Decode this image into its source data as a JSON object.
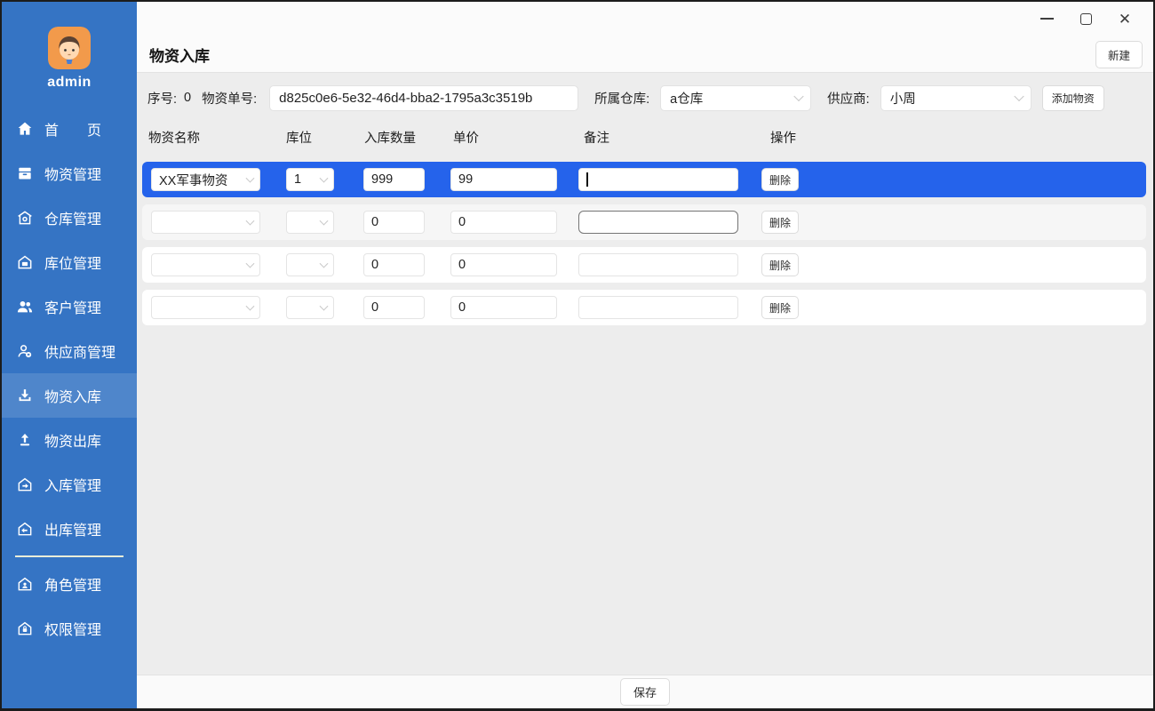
{
  "colors": {
    "sidebar_background": "#3574c4",
    "sidebar_selected": "#4f86cb",
    "row_selected": "#2563eb",
    "avatar_orange": "#f29a4b",
    "content_background": "#ededed"
  },
  "sidebar": {
    "avatar_name": "admin",
    "items": [
      {
        "label": "首　　页",
        "icon": "home-icon",
        "selected": false
      },
      {
        "label": "物资管理",
        "icon": "package-icon",
        "selected": false
      },
      {
        "label": "仓库管理",
        "icon": "warehouse-icon",
        "selected": false
      },
      {
        "label": "库位管理",
        "icon": "storage-location-icon",
        "selected": false
      },
      {
        "label": "客户管理",
        "icon": "customers-icon",
        "selected": false
      },
      {
        "label": "供应商管理",
        "icon": "supplier-icon",
        "selected": false
      },
      {
        "label": "物资入库",
        "icon": "download-icon",
        "selected": true
      },
      {
        "label": "物资出库",
        "icon": "upload-icon",
        "selected": false
      },
      {
        "label": "入库管理",
        "icon": "house-in-icon",
        "selected": false
      },
      {
        "label": "出库管理",
        "icon": "house-out-icon",
        "selected": false
      },
      {
        "label": "角色管理",
        "icon": "role-icon",
        "selected": false
      },
      {
        "label": "权限管理",
        "icon": "permission-icon",
        "selected": false
      }
    ]
  },
  "header": {
    "title": "物资入库",
    "new_button": "新建"
  },
  "toolbar": {
    "seq_label": "序号:",
    "seq_value": "0",
    "order_label": "物资单号:",
    "order_value": "d825c0e6-5e32-46d4-bba2-1795a3c3519b",
    "warehouse_label": "所属仓库:",
    "warehouse_value": "a仓库",
    "supplier_label": "供应商:",
    "supplier_value": "小周",
    "add_button": "添加物资"
  },
  "table": {
    "headers": [
      "物资名称",
      "库位",
      "入库数量",
      "单价",
      "备注",
      "操作"
    ],
    "delete_label": "删除",
    "rows": [
      {
        "material": "XX军事物资",
        "location": "1",
        "quantity": "999",
        "price": "99",
        "remark": "",
        "selected": true
      },
      {
        "material": "",
        "location": "",
        "quantity": "0",
        "price": "0",
        "remark": "",
        "selected": false
      },
      {
        "material": "",
        "location": "",
        "quantity": "0",
        "price": "0",
        "remark": "",
        "selected": false
      },
      {
        "material": "",
        "location": "",
        "quantity": "0",
        "price": "0",
        "remark": "",
        "selected": false
      }
    ]
  },
  "footer": {
    "save_button": "保存"
  }
}
